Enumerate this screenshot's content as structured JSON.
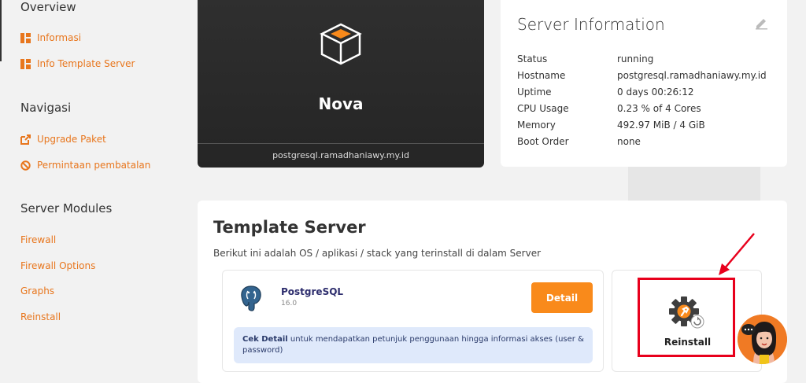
{
  "sidebar": {
    "overview_title": "Overview",
    "overview_items": [
      {
        "label": "Informasi"
      },
      {
        "label": "Info Template Server"
      }
    ],
    "nav_title": "Navigasi",
    "nav_items": [
      {
        "label": "Upgrade Paket"
      },
      {
        "label": "Permintaan pembatalan"
      }
    ],
    "modules_title": "Server Modules",
    "module_items": [
      {
        "label": "Firewall"
      },
      {
        "label": "Firewall Options"
      },
      {
        "label": "Graphs"
      },
      {
        "label": "Reinstall"
      }
    ]
  },
  "hero": {
    "product_name": "Nova",
    "hostname": "postgresql.ramadhaniawy.my.id"
  },
  "server_info": {
    "title": "Server Information",
    "rows": [
      {
        "key": "Status",
        "value": "running"
      },
      {
        "key": "Hostname",
        "value": "postgresql.ramadhaniawy.my.id"
      },
      {
        "key": "Uptime",
        "value": "0 days 00:26:12"
      },
      {
        "key": "CPU Usage",
        "value": "0.23 % of 4 Cores"
      },
      {
        "key": "Memory",
        "value": "492.97 MiB / 4 GiB"
      },
      {
        "key": "Boot Order",
        "value": "none"
      }
    ]
  },
  "template": {
    "title": "Template Server",
    "subtitle": "Berikut ini adalah OS / aplikasi / stack yang terinstall di dalam Server",
    "os_name": "PostgreSQL",
    "os_version": "16.0",
    "detail_label": "Detail",
    "note_bold": "Cek Detail",
    "note_text": " untuk mendapatkan petunjuk penggunaan hingga informasi akses (user & password)",
    "reinstall_label": "Reinstall"
  },
  "colors": {
    "accent": "#f98a1b",
    "link": "#e8761d",
    "highlight": "#e8001c"
  }
}
